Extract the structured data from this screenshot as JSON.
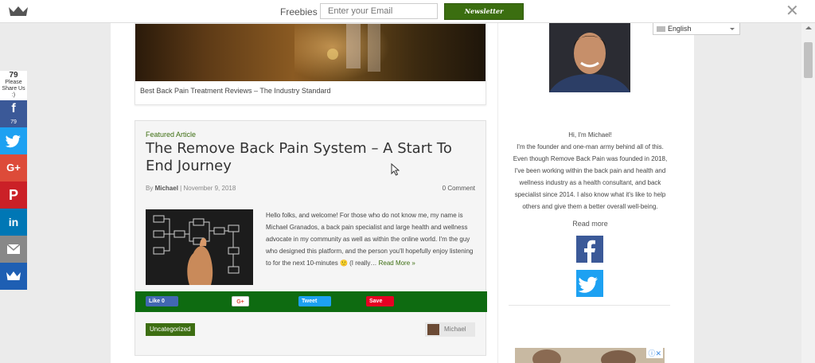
{
  "topbar": {
    "freebies_label": "Freebies",
    "email_placeholder": "Enter your Email",
    "newsletter_label": "Newsletter"
  },
  "language": {
    "selected": "English"
  },
  "social_sidebar": {
    "share_count": "79",
    "share_prompt_line1": "Please",
    "share_prompt_line2": "Share Us",
    "share_prompt_line3": ":)",
    "facebook_count": "79",
    "buttons": [
      "facebook",
      "twitter",
      "google-plus",
      "pinterest",
      "linkedin",
      "email",
      "sumo"
    ]
  },
  "first_post": {
    "caption": "Best Back Pain Treatment Reviews – The Industry Standard"
  },
  "featured_post": {
    "label": "Featured Article",
    "title": "The Remove Back Pain System – A Start To End Journey",
    "by": "By",
    "author": "Michael",
    "separator": "|",
    "date": "November 9, 2018",
    "comments": "0 Comment",
    "excerpt": "Hello folks, and welcome! For those who do not know me, my name is Michael Granados, a back pain specialist and large health and wellness advocate in my community as well as within the online world. I'm the guy who designed this platform, and the person you'll hopefully enjoy listening to for the next 10-minutes 🙂 (I really…",
    "read_more": "Read More »",
    "share_buttons": {
      "like": "Like 0",
      "gplus": "G+",
      "tweet": "Tweet",
      "save": "Save"
    },
    "category": "Uncategorized",
    "author_box_name": "Michael"
  },
  "sidebar": {
    "greeting": "Hi, I'm Michael!",
    "bio": "I'm the founder and one-man army behind all of this. Even though Remove Back Pain was founded in 2018, I've been working within the back pain and health and wellness industry as a health consultant, and back specialist since 2014. I also know what it's like to help others and give them a better overall well-being.",
    "read_more": "Read more"
  },
  "colors": {
    "brand_green": "#3d6e12",
    "share_bar_green": "#0e6b11",
    "facebook": "#3b5998",
    "twitter": "#1da1f2"
  }
}
